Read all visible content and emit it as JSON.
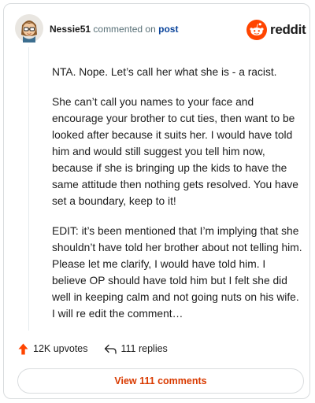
{
  "comment": {
    "username": "Nessie51",
    "commented_text": "commented on",
    "post_link": "post",
    "paragraphs": [
      "NTA. Nope. Let’s call her what she is - a racist.",
      "She can’t call you names to your face and encourage your brother to cut ties, then want to be looked after because it suits her. I would have told him and would still suggest you tell him now, because if she is bringing up the kids to have the same attitude then nothing gets resolved. You have set a boundary, keep to it!",
      "EDIT: it’s been mentioned that I’m implying that she shouldn’t have told her brother about not telling him. Please let me clarify, I would have told him. I believe OP should have told him but I felt she did well in keeping calm and not going nuts on his wife. I will re edit the comment…"
    ]
  },
  "branding": {
    "wordmark": "reddit",
    "accent_color": "#ff4500"
  },
  "actions": {
    "upvotes": "12K upvotes",
    "replies": "111 replies",
    "upvote_icon": "upvote-arrow-icon",
    "reply_icon": "reply-arrow-icon"
  },
  "view_button": {
    "label": "View 111 comments",
    "color": "#d93a00"
  }
}
